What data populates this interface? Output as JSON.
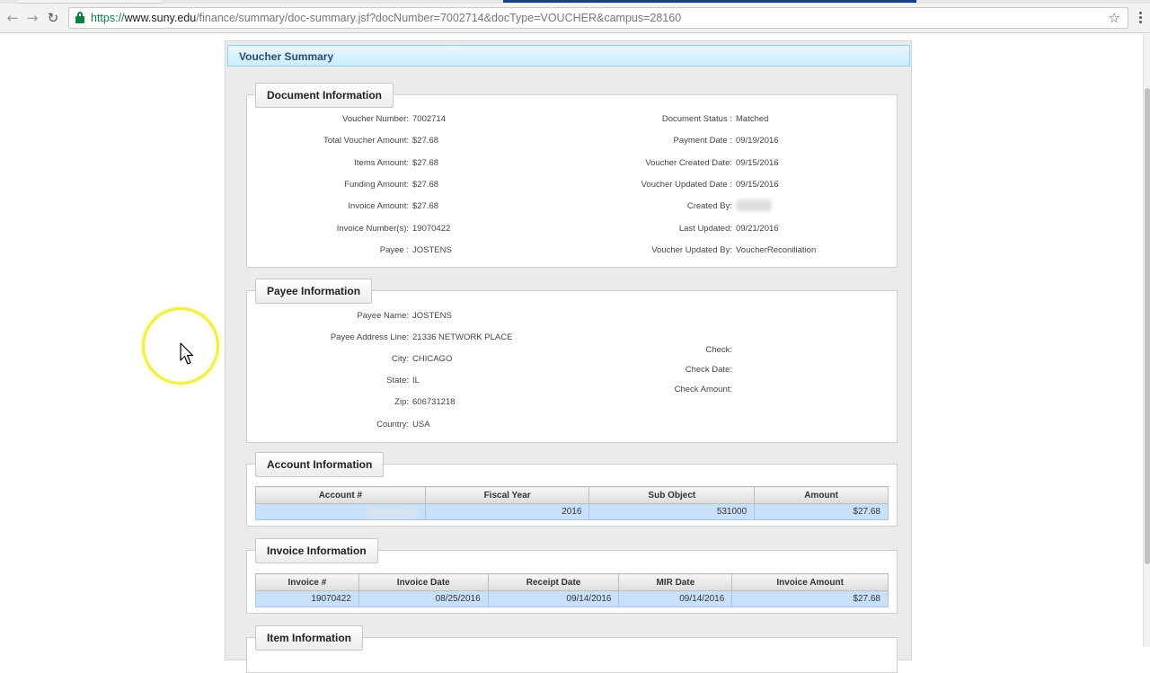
{
  "browser": {
    "url_scheme": "https://",
    "url_host": "www.suny.edu",
    "url_path": "/finance/summary/doc-summary.jsf?docNumber=7002714&docType=VOUCHER&campus=28160"
  },
  "page": {
    "title": "Voucher Summary"
  },
  "document_information": {
    "legend": "Document Information",
    "left": [
      {
        "label": "Voucher Number:",
        "value": "7002714"
      },
      {
        "label": "Total Voucher Amount:",
        "value": "$27.68"
      },
      {
        "label": "Items Amount:",
        "value": "$27.68"
      },
      {
        "label": "Funding Amount:",
        "value": "$27.68"
      },
      {
        "label": "Invoice Amount:",
        "value": "$27.68"
      },
      {
        "label": "Invoice Number(s):",
        "value": "19070422"
      },
      {
        "label": "Payee :",
        "value": "JOSTENS"
      }
    ],
    "right": [
      {
        "label": "Document Status :",
        "value": "Matched"
      },
      {
        "label": "Payment Date :",
        "value": "09/19/2016"
      },
      {
        "label": "Voucher Created Date:",
        "value": "09/15/2016"
      },
      {
        "label": "Voucher Updated Date :",
        "value": "09/15/2016"
      },
      {
        "label": "Created By:",
        "value": ""
      },
      {
        "label": "Last Updated:",
        "value": "09/21/2016"
      },
      {
        "label": "Voucher Updated By:",
        "value": "VoucherReconiliation"
      }
    ]
  },
  "payee_information": {
    "legend": "Payee Information",
    "left": [
      {
        "label": "Payee Name:",
        "value": "JOSTENS"
      },
      {
        "label": "Payee Address Line:",
        "value": "21336 NETWORK PLACE"
      },
      {
        "label": "City:",
        "value": "CHICAGO"
      },
      {
        "label": "State:",
        "value": "IL"
      },
      {
        "label": "Zip:",
        "value": "606731218"
      },
      {
        "label": "Country:",
        "value": "USA"
      }
    ],
    "right": [
      {
        "label": "Check:",
        "value": ""
      },
      {
        "label": "Check Date:",
        "value": ""
      },
      {
        "label": "Check Amount:",
        "value": ""
      }
    ]
  },
  "account_information": {
    "legend": "Account Information",
    "columns": [
      "Account #",
      "Fiscal Year",
      "Sub Object",
      "Amount"
    ],
    "rows": [
      {
        "account": "",
        "fiscal_year": "2016",
        "sub_object": "531000",
        "amount": "$27.68"
      }
    ]
  },
  "invoice_information": {
    "legend": "Invoice Information",
    "columns": [
      "Invoice #",
      "Invoice Date",
      "Receipt Date",
      "MIR Date",
      "Invoice Amount"
    ],
    "rows": [
      {
        "invoice": "19070422",
        "invoice_date": "08/25/2016",
        "receipt_date": "09/14/2016",
        "mir_date": "09/14/2016",
        "amount": "$27.68"
      }
    ]
  },
  "item_information": {
    "legend": "Item Information"
  },
  "icons": {
    "back": "back-arrow-icon",
    "forward": "forward-arrow-icon",
    "reload": "reload-icon",
    "lock": "lock-icon",
    "bookmark": "star-icon",
    "menu": "menu-dots-icon",
    "cursor": "mouse-cursor-icon"
  },
  "colors": {
    "header_bg": "#cbeeff",
    "header_text": "#2b4a78",
    "row_bg": "#c9e0fb",
    "secure_green": "#0b8043",
    "cursor_halo": "#f1ee46"
  }
}
